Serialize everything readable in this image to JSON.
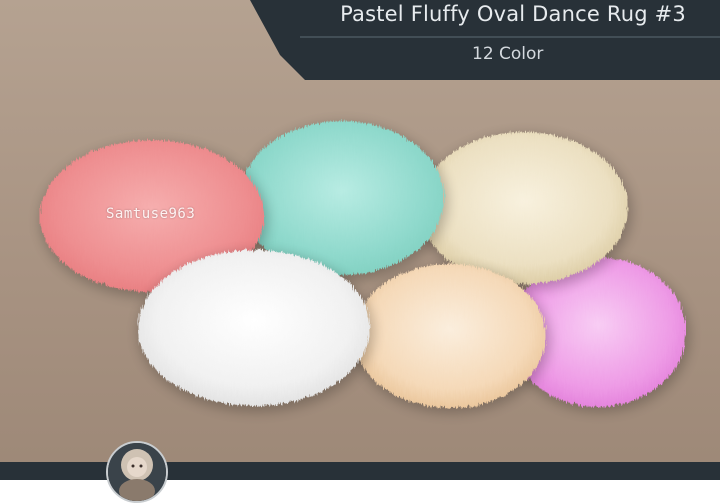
{
  "header": {
    "title": "Pastel Fluffy Oval Dance Rug #3",
    "subtitle": "12 Color"
  },
  "watermark": "Samtuse963",
  "rugs": [
    {
      "name": "pink",
      "color": "#ef8c8f"
    },
    {
      "name": "mint",
      "color": "#8fd9cc"
    },
    {
      "name": "beige",
      "color": "#ece0c2"
    },
    {
      "name": "white",
      "color": "#f3f3f3"
    },
    {
      "name": "peach",
      "color": "#f5d9b8"
    },
    {
      "name": "lilac",
      "color": "#ee9be6"
    }
  ],
  "colors": {
    "background": "#ab9685",
    "banner": "#283138"
  }
}
